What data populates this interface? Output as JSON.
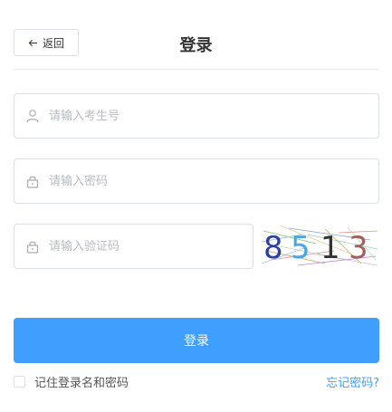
{
  "header": {
    "back_label": "返回",
    "title": "登录"
  },
  "form": {
    "username_placeholder": "请输入考生号",
    "password_placeholder": "请输入密码",
    "captcha_placeholder": "请输入验证码",
    "captcha_digits": [
      "8",
      "5",
      "1",
      "3"
    ]
  },
  "actions": {
    "login_label": "登录",
    "remember_label": "记住登录名和密码",
    "forgot_label": "忘记密码?"
  },
  "colors": {
    "primary": "#409eff",
    "border": "#dcdfe6",
    "placeholder": "#b8bcc3"
  },
  "icons": {
    "back": "arrow-left-icon",
    "username": "user-icon",
    "password": "lock-icon",
    "captcha": "lock-icon"
  }
}
